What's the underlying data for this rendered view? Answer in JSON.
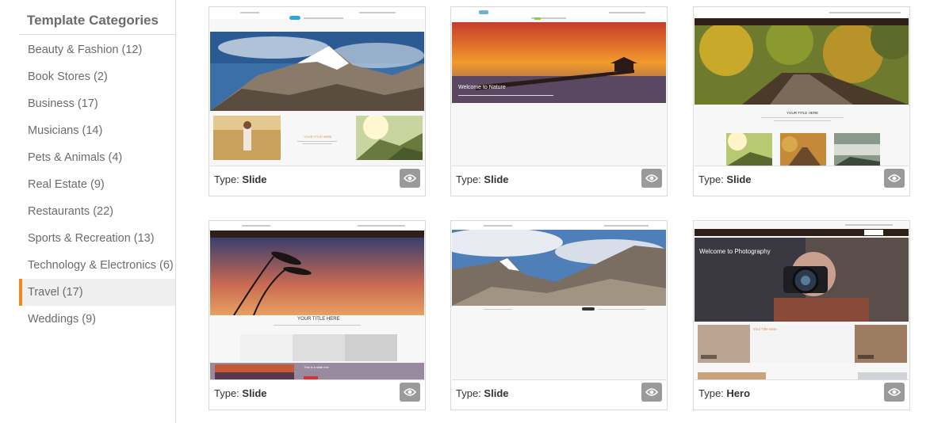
{
  "sidebar": {
    "title": "Template Categories",
    "items": [
      {
        "label": "Beauty & Fashion (12)",
        "active": false
      },
      {
        "label": "Book Stores (2)",
        "active": false
      },
      {
        "label": "Business (17)",
        "active": false
      },
      {
        "label": "Musicians (14)",
        "active": false
      },
      {
        "label": "Pets & Animals (4)",
        "active": false
      },
      {
        "label": "Real Estate (9)",
        "active": false
      },
      {
        "label": "Restaurants (22)",
        "active": false
      },
      {
        "label": "Sports & Recreation (13)",
        "active": false
      },
      {
        "label": "Technology & Electronics (6)",
        "active": false
      },
      {
        "label": "Travel (17)",
        "active": true
      },
      {
        "label": "Weddings (9)",
        "active": false
      }
    ],
    "accent_color": "#f08a1c"
  },
  "templates": [
    {
      "type_label": "Type:",
      "type_value": "Slide",
      "thumb_title": "YOUR TITLE HERE",
      "preview_icon": "eye-icon"
    },
    {
      "type_label": "Type:",
      "type_value": "Slide",
      "thumb_title": "Welcome to Nature",
      "preview_icon": "eye-icon"
    },
    {
      "type_label": "Type:",
      "type_value": "Slide",
      "thumb_title": "YOUR TITLE HERE",
      "preview_icon": "eye-icon"
    },
    {
      "type_label": "Type:",
      "type_value": "Slide",
      "thumb_title": "YOUR TITLE HERE",
      "thumb_subtitle": "This is a slide box",
      "preview_icon": "eye-icon"
    },
    {
      "type_label": "Type:",
      "type_value": "Slide",
      "preview_icon": "eye-icon"
    },
    {
      "type_label": "Type:",
      "type_value": "Hero",
      "thumb_title": "Welcome to Photography",
      "thumb_subtitle": "Your Title Here",
      "preview_icon": "eye-icon"
    }
  ]
}
